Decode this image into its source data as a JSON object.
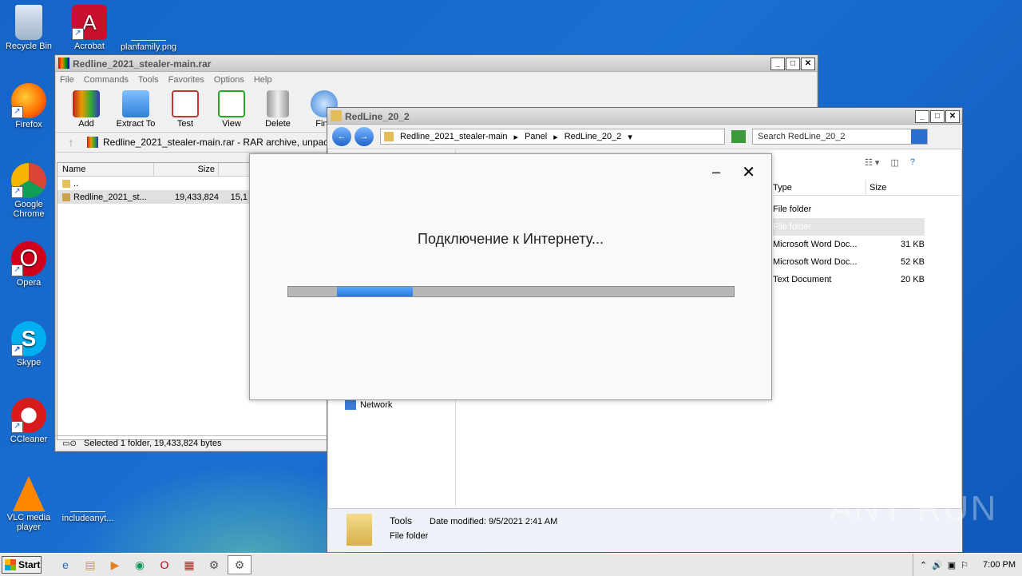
{
  "desktop": {
    "icons": [
      {
        "label": "Recycle Bin"
      },
      {
        "label": "Acrobat"
      },
      {
        "label": "planfamily.png"
      },
      {
        "label": "Firefox"
      },
      {
        "label": "Google Chrome"
      },
      {
        "label": "Opera"
      },
      {
        "label": "Skype"
      },
      {
        "label": "CCleaner"
      },
      {
        "label": "VLC media player"
      },
      {
        "label": "includeanyt..."
      }
    ]
  },
  "winrar": {
    "title": "Redline_2021_stealer-main.rar",
    "menu": [
      "File",
      "Commands",
      "Tools",
      "Favorites",
      "Options",
      "Help"
    ],
    "toolbar": [
      "Add",
      "Extract To",
      "Test",
      "View",
      "Delete",
      "Find"
    ],
    "address": "Redline_2021_stealer-main.rar - RAR archive, unpacke",
    "columns": {
      "name": "Name",
      "size": "Size"
    },
    "rows": [
      {
        "name": "..",
        "size": "",
        "packed": ""
      },
      {
        "name": "Redline_2021_st...",
        "size": "19,433,824",
        "packed": "15,1"
      }
    ],
    "status": "Selected 1 folder, 19,433,824 bytes"
  },
  "explorer": {
    "title": "RedLine_20_2",
    "breadcrumb": [
      "Redline_2021_stealer-main",
      "Panel",
      "RedLine_20_2"
    ],
    "search_placeholder": "Search RedLine_20_2",
    "columns": {
      "type": "Type",
      "size": "Size"
    },
    "rows": [
      {
        "type": "File folder",
        "size": ""
      },
      {
        "type": "File folder",
        "size": ""
      },
      {
        "type": "Microsoft Word Doc...",
        "size": "31 KB"
      },
      {
        "type": "Microsoft Word Doc...",
        "size": "52 KB"
      },
      {
        "type": "Text Document",
        "size": "20 KB"
      }
    ],
    "nav_network": "Network",
    "details": {
      "name": "Tools",
      "modified_label": "Date modified:",
      "modified": "9/5/2021 2:41 AM",
      "kind": "File folder"
    }
  },
  "dialog": {
    "message": "Подключение к Интернету...",
    "progress": 0.17
  },
  "taskbar": {
    "start": "Start",
    "clock": "7:00 PM"
  },
  "watermark": "ANY RUN",
  "colors": {
    "desktop": "#1565c8",
    "progress": "#2a79e0"
  }
}
